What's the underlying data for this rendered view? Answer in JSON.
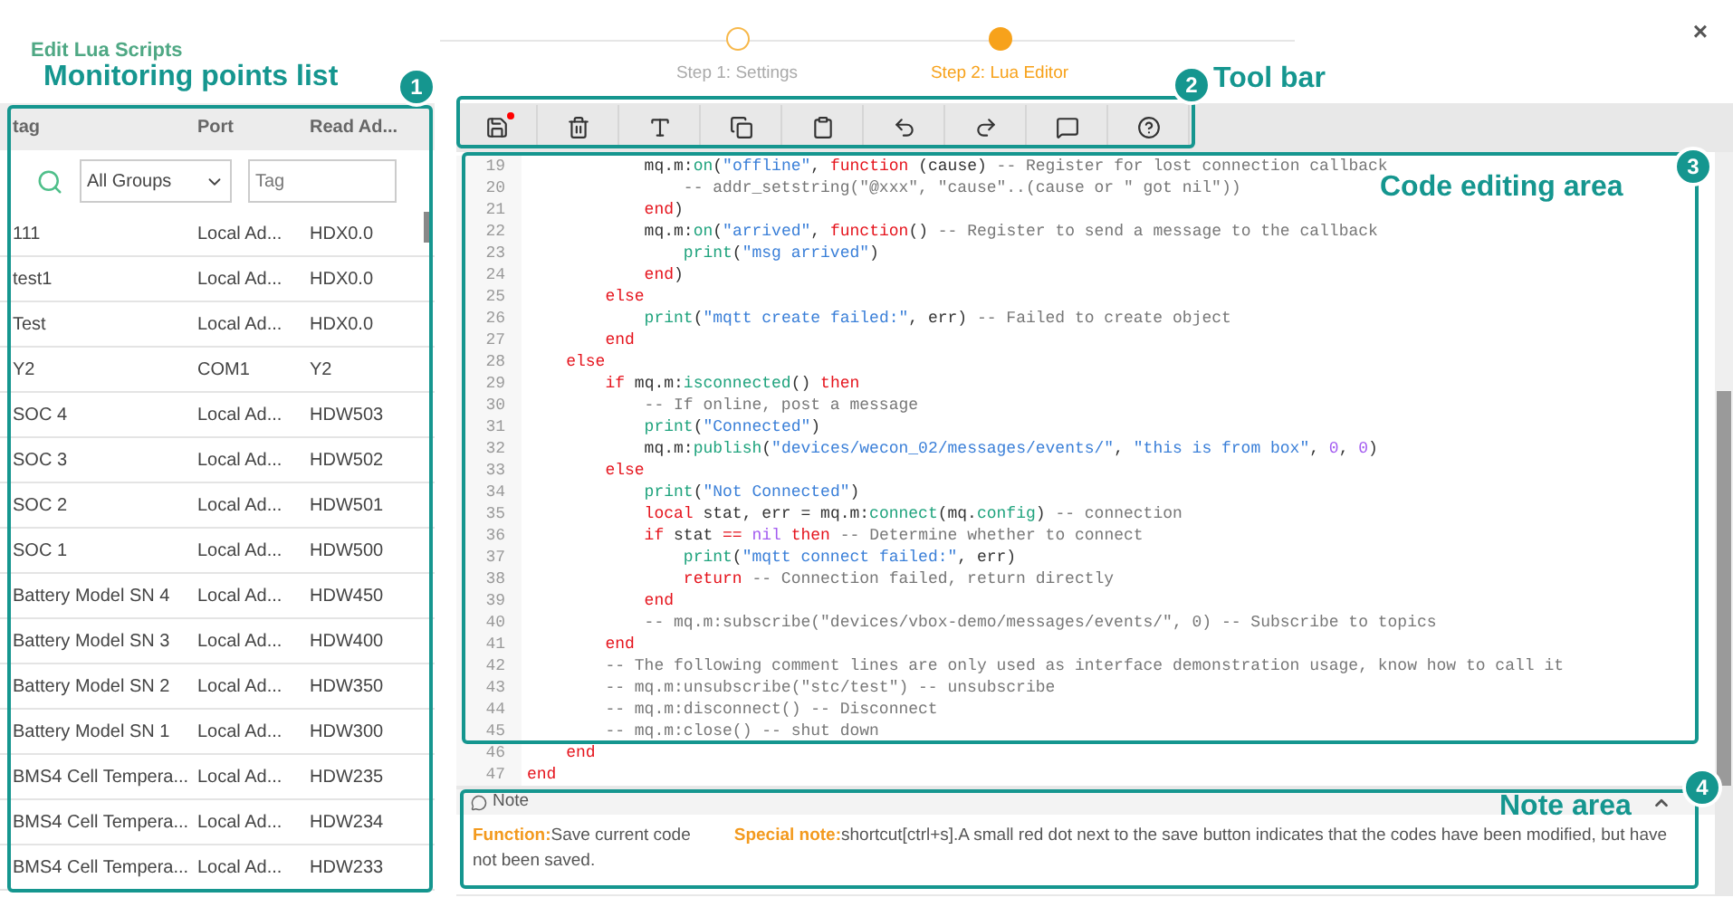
{
  "window": {
    "title": "Edit Lua Scripts",
    "close": "×"
  },
  "steps": [
    {
      "label": "Step 1: Settings",
      "selected": false
    },
    {
      "label": "Step 2: Lua Editor",
      "selected": true
    }
  ],
  "points_list": {
    "columns": [
      "tag",
      "Port",
      "Read Ad..."
    ],
    "group_filter": "All Groups",
    "tag_placeholder": "Tag",
    "rows": [
      [
        "111",
        "Local Ad...",
        "HDX0.0"
      ],
      [
        "test1",
        "Local Ad...",
        "HDX0.0"
      ],
      [
        "Test",
        "Local Ad...",
        "HDX0.0"
      ],
      [
        "Y2",
        "COM1",
        "Y2"
      ],
      [
        "SOC 4",
        "Local Ad...",
        "HDW503"
      ],
      [
        "SOC 3",
        "Local Ad...",
        "HDW502"
      ],
      [
        "SOC 2",
        "Local Ad...",
        "HDW501"
      ],
      [
        "SOC 1",
        "Local Ad...",
        "HDW500"
      ],
      [
        "Battery Model SN 4",
        "Local Ad...",
        "HDW450"
      ],
      [
        "Battery Model SN 3",
        "Local Ad...",
        "HDW400"
      ],
      [
        "Battery Model SN 2",
        "Local Ad...",
        "HDW350"
      ],
      [
        "Battery Model SN 1",
        "Local Ad...",
        "HDW300"
      ],
      [
        "BMS4 Cell Tempera...",
        "Local Ad...",
        "HDW235"
      ],
      [
        "BMS4 Cell Tempera...",
        "Local Ad...",
        "HDW234"
      ],
      [
        "BMS4 Cell Tempera...",
        "Local Ad...",
        "HDW233"
      ]
    ]
  },
  "toolbar": {
    "unsaved_changes": true
  },
  "code": [
    {
      "number": "19",
      "tokens": [
        {
          "text": "            mq.m:",
          "kind": "plain"
        },
        {
          "text": "on",
          "kind": "builtin"
        },
        {
          "text": "(",
          "kind": "plain"
        },
        {
          "text": "\"offline\"",
          "kind": "string"
        },
        {
          "text": ", ",
          "kind": "plain"
        },
        {
          "text": "function",
          "kind": "keyword"
        },
        {
          "text": " (cause) ",
          "kind": "plain"
        },
        {
          "text": "-- Register for lost connection callback",
          "kind": "comment"
        }
      ]
    },
    {
      "number": "20",
      "tokens": [
        {
          "text": "                -- addr_setstring(\"@xxx\", \"cause\"..(cause or \" got nil\"))",
          "kind": "comment"
        }
      ]
    },
    {
      "number": "21",
      "tokens": [
        {
          "text": "            end",
          "kind": "keyword"
        },
        {
          "text": ")",
          "kind": "plain"
        }
      ]
    },
    {
      "number": "22",
      "tokens": [
        {
          "text": "            mq.m:",
          "kind": "plain"
        },
        {
          "text": "on",
          "kind": "builtin"
        },
        {
          "text": "(",
          "kind": "plain"
        },
        {
          "text": "\"arrived\"",
          "kind": "string"
        },
        {
          "text": ", ",
          "kind": "plain"
        },
        {
          "text": "function",
          "kind": "keyword"
        },
        {
          "text": "() ",
          "kind": "plain"
        },
        {
          "text": "-- Register to send a message to the callback",
          "kind": "comment"
        }
      ]
    },
    {
      "number": "23",
      "tokens": [
        {
          "text": "                print",
          "kind": "builtin"
        },
        {
          "text": "(",
          "kind": "plain"
        },
        {
          "text": "\"msg arrived\"",
          "kind": "string"
        },
        {
          "text": ")",
          "kind": "plain"
        }
      ]
    },
    {
      "number": "24",
      "tokens": [
        {
          "text": "            end",
          "kind": "keyword"
        },
        {
          "text": ")",
          "kind": "plain"
        }
      ]
    },
    {
      "number": "25",
      "tokens": [
        {
          "text": "        else",
          "kind": "keyword"
        }
      ]
    },
    {
      "number": "26",
      "tokens": [
        {
          "text": "            print",
          "kind": "builtin"
        },
        {
          "text": "(",
          "kind": "plain"
        },
        {
          "text": "\"mqtt create failed:\"",
          "kind": "string"
        },
        {
          "text": ", err) ",
          "kind": "plain"
        },
        {
          "text": "-- Failed to create object",
          "kind": "comment"
        }
      ]
    },
    {
      "number": "27",
      "tokens": [
        {
          "text": "        end",
          "kind": "keyword"
        }
      ]
    },
    {
      "number": "28",
      "tokens": [
        {
          "text": "    else",
          "kind": "keyword"
        }
      ]
    },
    {
      "number": "29",
      "tokens": [
        {
          "text": "        if",
          "kind": "keyword"
        },
        {
          "text": " mq.m:",
          "kind": "plain"
        },
        {
          "text": "isconnected",
          "kind": "builtin"
        },
        {
          "text": "() ",
          "kind": "plain"
        },
        {
          "text": "then",
          "kind": "keyword"
        }
      ]
    },
    {
      "number": "30",
      "tokens": [
        {
          "text": "            -- If online, post a message",
          "kind": "comment"
        }
      ]
    },
    {
      "number": "31",
      "tokens": [
        {
          "text": "            print",
          "kind": "builtin"
        },
        {
          "text": "(",
          "kind": "plain"
        },
        {
          "text": "\"Connected\"",
          "kind": "string"
        },
        {
          "text": ")",
          "kind": "plain"
        }
      ]
    },
    {
      "number": "32",
      "tokens": [
        {
          "text": "            mq.m:",
          "kind": "plain"
        },
        {
          "text": "publish",
          "kind": "builtin"
        },
        {
          "text": "(",
          "kind": "plain"
        },
        {
          "text": "\"devices/wecon_02/messages/events/\"",
          "kind": "string"
        },
        {
          "text": ", ",
          "kind": "plain"
        },
        {
          "text": "\"this is from box\"",
          "kind": "string"
        },
        {
          "text": ", ",
          "kind": "plain"
        },
        {
          "text": "0",
          "kind": "number"
        },
        {
          "text": ", ",
          "kind": "plain"
        },
        {
          "text": "0",
          "kind": "number"
        },
        {
          "text": ")",
          "kind": "plain"
        }
      ]
    },
    {
      "number": "33",
      "tokens": [
        {
          "text": "        else",
          "kind": "keyword"
        }
      ]
    },
    {
      "number": "34",
      "tokens": [
        {
          "text": "            print",
          "kind": "builtin"
        },
        {
          "text": "(",
          "kind": "plain"
        },
        {
          "text": "\"Not Connected\"",
          "kind": "string"
        },
        {
          "text": ")",
          "kind": "plain"
        }
      ]
    },
    {
      "number": "35",
      "tokens": [
        {
          "text": "            local",
          "kind": "keyword"
        },
        {
          "text": " stat, err = mq.m:",
          "kind": "plain"
        },
        {
          "text": "connect",
          "kind": "builtin"
        },
        {
          "text": "(mq.",
          "kind": "plain"
        },
        {
          "text": "config",
          "kind": "builtin"
        },
        {
          "text": ") ",
          "kind": "plain"
        },
        {
          "text": "-- connection",
          "kind": "comment"
        }
      ]
    },
    {
      "number": "36",
      "tokens": [
        {
          "text": "            if",
          "kind": "keyword"
        },
        {
          "text": " stat ",
          "kind": "plain"
        },
        {
          "text": "==",
          "kind": "keyword"
        },
        {
          "text": " nil",
          "kind": "number"
        },
        {
          "text": " then",
          "kind": "keyword"
        },
        {
          "text": " -- Determine whether to connect",
          "kind": "comment"
        }
      ]
    },
    {
      "number": "37",
      "tokens": [
        {
          "text": "                print",
          "kind": "builtin"
        },
        {
          "text": "(",
          "kind": "plain"
        },
        {
          "text": "\"mqtt connect failed:\"",
          "kind": "string"
        },
        {
          "text": ", err)",
          "kind": "plain"
        }
      ]
    },
    {
      "number": "38",
      "tokens": [
        {
          "text": "                return",
          "kind": "keyword"
        },
        {
          "text": " -- Connection failed, return directly",
          "kind": "comment"
        }
      ]
    },
    {
      "number": "39",
      "tokens": [
        {
          "text": "            end",
          "kind": "keyword"
        }
      ]
    },
    {
      "number": "40",
      "tokens": [
        {
          "text": "            -- mq.m:subscribe(\"devices/vbox-demo/messages/events/\", 0) -- Subscribe to topics",
          "kind": "comment"
        }
      ]
    },
    {
      "number": "41",
      "tokens": [
        {
          "text": "        end",
          "kind": "keyword"
        }
      ]
    },
    {
      "number": "42",
      "tokens": [
        {
          "text": "        -- The following comment lines are only used as interface demonstration usage, know how to call it",
          "kind": "comment"
        }
      ]
    },
    {
      "number": "43",
      "tokens": [
        {
          "text": "        -- mq.m:unsubscribe(\"stc/test\") -- unsubscribe",
          "kind": "comment"
        }
      ]
    },
    {
      "number": "44",
      "tokens": [
        {
          "text": "        -- mq.m:disconnect() -- Disconnect",
          "kind": "comment"
        }
      ]
    },
    {
      "number": "45",
      "tokens": [
        {
          "text": "        -- mq.m:close() -- shut down",
          "kind": "comment"
        }
      ]
    },
    {
      "number": "46",
      "tokens": [
        {
          "text": "    end",
          "kind": "keyword"
        }
      ]
    },
    {
      "number": "47",
      "tokens": [
        {
          "text": "end",
          "kind": "keyword"
        }
      ]
    }
  ],
  "note": {
    "title": "Note",
    "expanded": true,
    "function_label": "Function:",
    "function_text": "Save current code",
    "special_label": "Special note:",
    "special_text": "shortcut[ctrl+s].A small red dot next to the save button indicates that the codes have been modified, but have not been saved."
  },
  "annotations": [
    {
      "number": "1",
      "label": "Monitoring points list"
    },
    {
      "number": "2",
      "label": "Tool bar"
    },
    {
      "number": "3",
      "label": "Code editing area"
    },
    {
      "number": "4",
      "label": "Note area"
    }
  ]
}
